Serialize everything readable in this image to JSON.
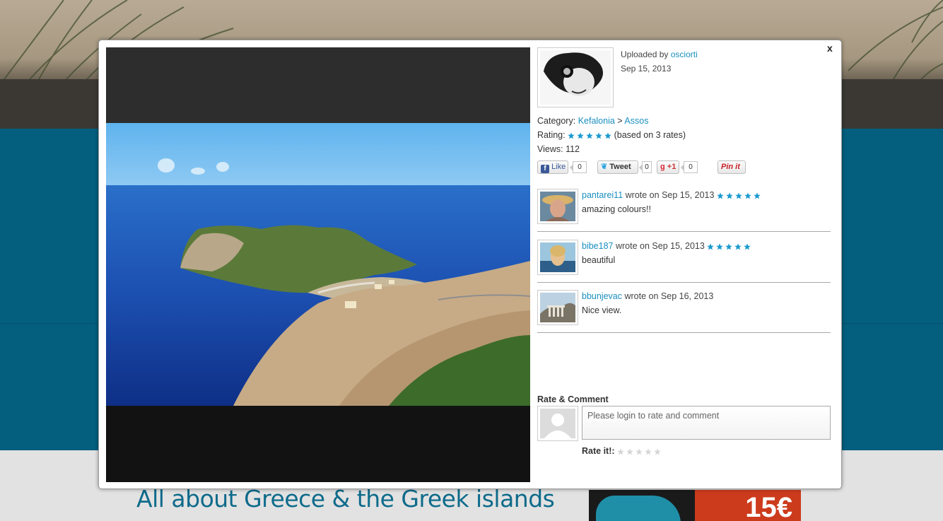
{
  "uploader": {
    "prefix": "Uploaded by",
    "name": "osciorti",
    "date": "Sep 15, 2013"
  },
  "meta": {
    "category_label": "Category:",
    "category": "Kefalonia",
    "category_sep": ">",
    "subcategory": "Assos",
    "rating_label": "Rating:",
    "rating_value": 5,
    "rating_text": "(based on 3 rates)",
    "views_label": "Views:",
    "views": "112"
  },
  "social": {
    "like_label": "Like",
    "like_count": "0",
    "tweet_label": "Tweet",
    "tweet_count": "0",
    "gplus_label": "+1",
    "gplus_count": "0",
    "pin_label": "Pin it"
  },
  "comments": [
    {
      "user": "pantarei11",
      "wrote": "wrote on",
      "date": "Sep 15, 2013",
      "rating": 5,
      "text": "amazing colours!!"
    },
    {
      "user": "bibe187",
      "wrote": "wrote on",
      "date": "Sep 15, 2013",
      "rating": 5,
      "text": "beautiful"
    },
    {
      "user": "bbunjevac",
      "wrote": "wrote on",
      "date": "Sep 16, 2013",
      "rating": 0,
      "text": "Nice view."
    }
  ],
  "rate_comment": {
    "title": "Rate & Comment",
    "placeholder": "Please login to rate and comment",
    "rate_label": "Rate it!:",
    "rate_value": 0
  },
  "close_label": "x",
  "background": {
    "heading": "All about Greece & the Greek islands",
    "ad_text": "15€"
  },
  "colors": {
    "link": "#1a8fc0",
    "star": "#1a9ad0",
    "star_empty": "#d6d6d6",
    "teal": "#045f7e"
  }
}
